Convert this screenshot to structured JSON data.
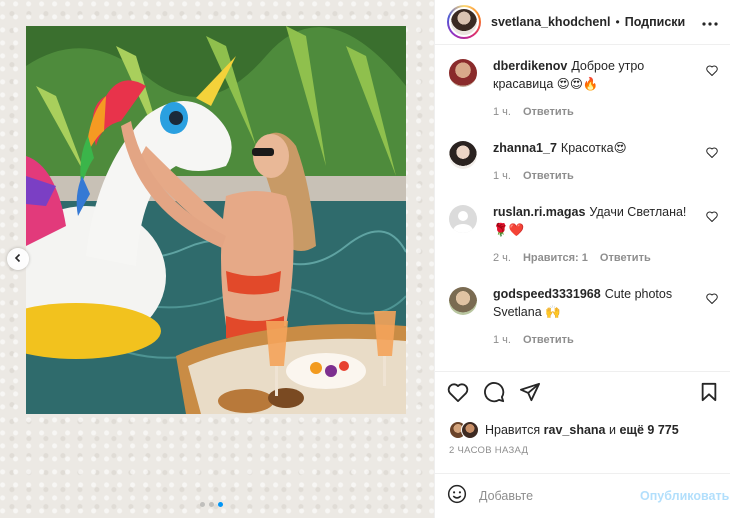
{
  "post": {
    "author": "svetlana_khodchenl",
    "separator": "•",
    "follow_label": "Подписки",
    "more_label": "•••"
  },
  "media": {
    "carousel_total": 3,
    "carousel_active": 3
  },
  "comments": [
    {
      "user": "dberdikenov",
      "text": "Доброе утро красавица 😍😍🔥",
      "time": "1 ч.",
      "reply": "Ответить",
      "likes": ""
    },
    {
      "user": "zhanna1_7",
      "text": "Красотка😍",
      "time": "1 ч.",
      "reply": "Ответить",
      "likes": ""
    },
    {
      "user": "ruslan.ri.magas",
      "text": "Удачи Светлана! 🌹❤️",
      "time": "2 ч.",
      "reply": "Ответить",
      "likes": "Нравится: 1"
    },
    {
      "user": "godspeed3331968",
      "text": "Cute photos Svetlana 🙌",
      "time": "1 ч.",
      "reply": "Ответить",
      "likes": ""
    }
  ],
  "likes": {
    "prefix": "Нравится",
    "user": "rav_shana",
    "middle": "и",
    "rest": "ещё 9 775"
  },
  "timestamp": "2 ЧАСОВ НАЗАД",
  "add_comment": {
    "placeholder": "Добавьте",
    "publish_label": "Опубликовать"
  },
  "colors": {
    "accent": "#0095f6",
    "publish_disabled": "#b2dffc",
    "secondary_text": "#8e8e8e"
  },
  "icons": [
    "chevron-left-icon",
    "more-icon",
    "heart-icon",
    "comment-icon",
    "share-icon",
    "bookmark-icon",
    "emoji-icon"
  ]
}
